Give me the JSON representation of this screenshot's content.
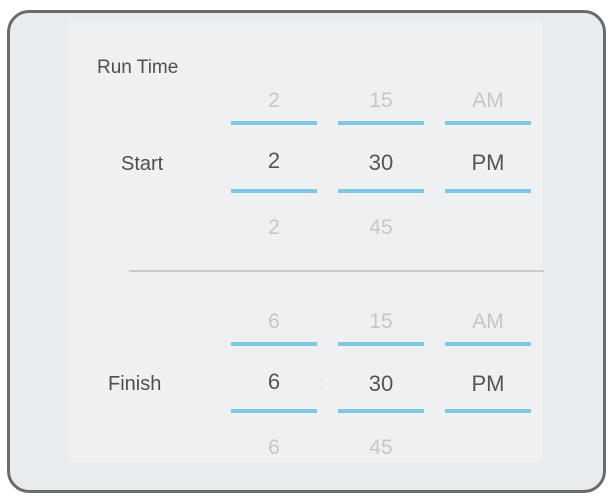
{
  "section_title": "Run Time",
  "separator": ":",
  "start": {
    "label": "Start",
    "hour": {
      "prev": "2",
      "value": "2",
      "next": "2"
    },
    "minute": {
      "prev": "15",
      "value": "30",
      "next": "45"
    },
    "period": {
      "prev": "AM",
      "value": "PM"
    }
  },
  "finish": {
    "label": "Finish",
    "hour": {
      "prev": "6",
      "value": "6",
      "next": "6"
    },
    "minute": {
      "prev": "15",
      "value": "30",
      "next": "45"
    },
    "period": {
      "prev": "AM",
      "value": "PM"
    }
  },
  "colors": {
    "accent_line": "#7ec8e3",
    "panel_border": "#6b6b6b",
    "panel_bg": "#e9ecee"
  }
}
